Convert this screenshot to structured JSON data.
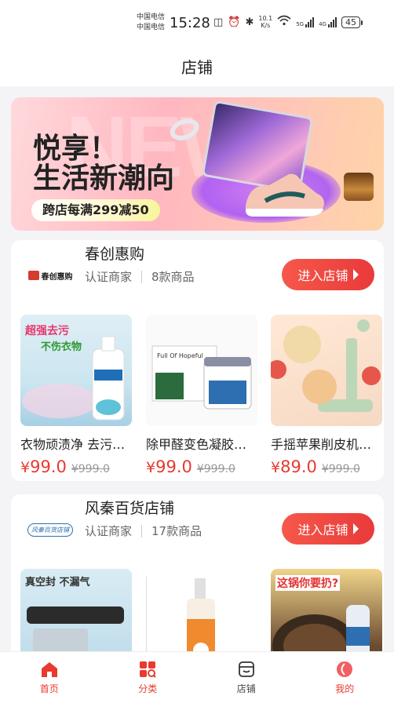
{
  "status_bar": {
    "carrier_1": "中国电信",
    "carrier_2": "中国电信",
    "time": "15:28",
    "net_speed_value": "10.1",
    "net_speed_unit": "K/s",
    "gen_1": "5G",
    "gen_2": "4G",
    "battery": "45"
  },
  "header": {
    "title": "店铺"
  },
  "banner": {
    "bg_text": "NEW",
    "line1": "悦享！",
    "line2": "生活新潮向",
    "promo": "跨店每满299减50"
  },
  "shops": [
    {
      "name": "春创惠购",
      "logo_text": "春创惠购",
      "badge": "认证商家",
      "count": "8款商品",
      "enter_label": "进入店铺",
      "products": [
        {
          "name": "衣物顽渍净 去污渍强力去除",
          "price": "99.0",
          "original": "¥999.0",
          "thumb_text_1": "超强去污",
          "thumb_text_2": "不伤衣物"
        },
        {
          "name": "除甲醛变色凝胶新房",
          "price": "99.0",
          "original": "¥999.0",
          "thumb_text_1": "Full Of Hopeful"
        },
        {
          "name": "手摇苹果削皮机家用",
          "price": "89.0",
          "original": "¥999.0"
        }
      ]
    },
    {
      "name": "风秦百货店铺",
      "logo_text": "风秦百货店铺",
      "badge": "认证商家",
      "count": "17款商品",
      "enter_label": "进入店铺",
      "products": [
        {
          "thumb_text_1": "真空封 不漏气"
        },
        {
          "thumb_text_1": ""
        },
        {
          "thumb_text_1": "这锅你要扔?"
        }
      ]
    }
  ],
  "currency": "¥",
  "nav": [
    {
      "label": "首页",
      "icon": "home-icon"
    },
    {
      "label": "分类",
      "icon": "category-icon"
    },
    {
      "label": "店铺",
      "icon": "store-icon"
    },
    {
      "label": "我的",
      "icon": "profile-icon"
    }
  ],
  "colors": {
    "accent": "#e83a2e",
    "banner_pink": "#ffb7c0"
  }
}
